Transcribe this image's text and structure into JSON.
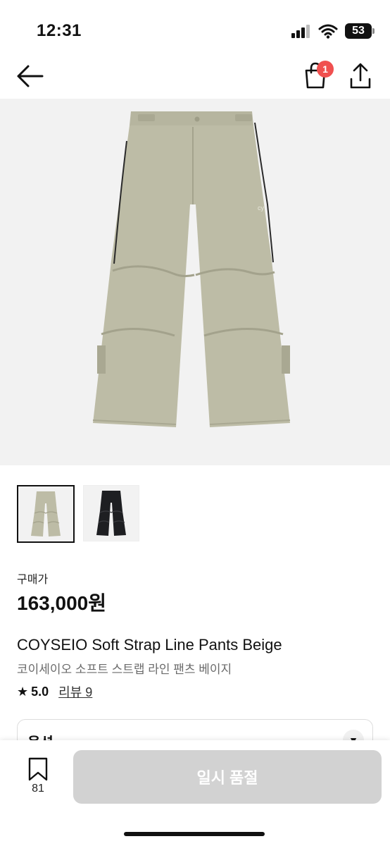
{
  "status_bar": {
    "time": "12:31",
    "battery": "53"
  },
  "nav": {
    "cart_badge": "1"
  },
  "gallery": {
    "selected_index": 0,
    "colors": {
      "beige": "#bdbca6",
      "beige_shadow": "#a9a892",
      "black": "#1e1f22",
      "piping": "#2a2a2a",
      "background": "#f2f2f2"
    }
  },
  "product": {
    "price_label": "구매가",
    "price": "163,000원",
    "title": "COYSEIO Soft Strap Line Pants Beige",
    "subtitle": "코이세이오 소프트 스트랩 라인 팬츠 베이지",
    "rating": "5.0",
    "review_link": "리뷰 9"
  },
  "option": {
    "label": "옵션"
  },
  "bottom": {
    "wish_count": "81",
    "soldout_label": "일시 품절"
  }
}
